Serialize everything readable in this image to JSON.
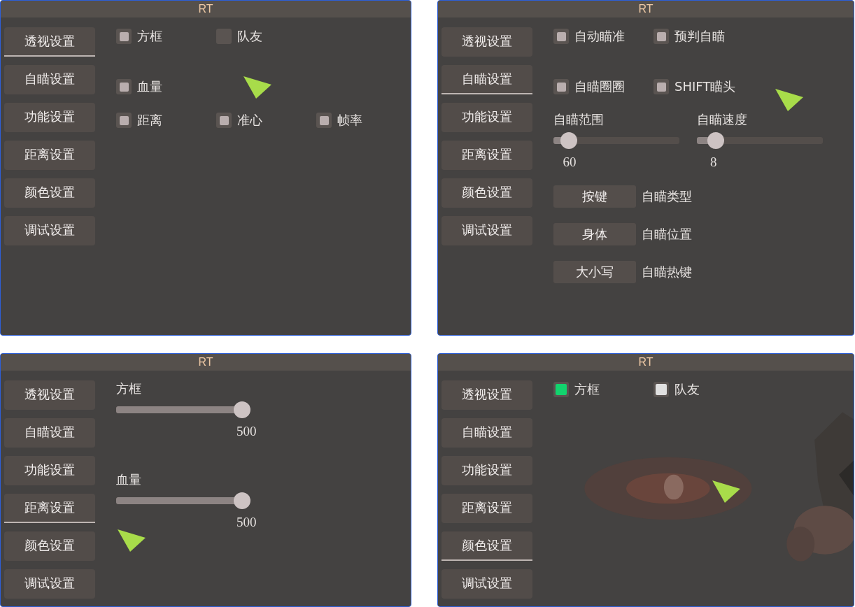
{
  "panels": [
    {
      "title": "RT",
      "tabs": [
        {
          "label": "透视设置",
          "selected": true
        },
        {
          "label": "自瞄设置",
          "selected": false
        },
        {
          "label": "功能设置",
          "selected": false
        },
        {
          "label": "距离设置",
          "selected": false
        },
        {
          "label": "颜色设置",
          "selected": false
        },
        {
          "label": "调试设置",
          "selected": false
        }
      ],
      "rows": [
        [
          {
            "kind": "checkbox",
            "label": "方框",
            "checked": true
          },
          {
            "kind": "checkbox",
            "label": "队友",
            "checked": false
          }
        ],
        [
          {
            "kind": "checkbox",
            "label": "血量",
            "checked": true
          }
        ],
        [
          {
            "kind": "checkbox",
            "label": "距离",
            "checked": true
          },
          {
            "kind": "checkbox",
            "label": "准心",
            "checked": true
          },
          {
            "kind": "checkbox",
            "label": "帧率",
            "checked": true
          }
        ]
      ]
    },
    {
      "title": "RT",
      "tabs": [
        {
          "label": "透视设置",
          "selected": false
        },
        {
          "label": "自瞄设置",
          "selected": true
        },
        {
          "label": "功能设置",
          "selected": false
        },
        {
          "label": "距离设置",
          "selected": false
        },
        {
          "label": "颜色设置",
          "selected": false
        },
        {
          "label": "调试设置",
          "selected": false
        }
      ],
      "rows": [
        [
          {
            "kind": "checkbox",
            "label": "自动瞄准",
            "checked": true
          },
          {
            "kind": "checkbox",
            "label": "预判自瞄",
            "checked": true
          }
        ],
        [
          {
            "kind": "checkbox",
            "label": "自瞄圈圈",
            "checked": true
          },
          {
            "kind": "checkbox",
            "label": "SHIFT瞄头",
            "checked": true
          }
        ],
        [
          {
            "kind": "slider",
            "label": "自瞄范围",
            "level": 0.12,
            "reading": "60"
          },
          {
            "kind": "slider",
            "label": "自瞄速度",
            "level": 0.15,
            "reading": "8"
          }
        ],
        [
          {
            "kind": "option",
            "value": "按键",
            "label": "自瞄类型"
          }
        ],
        [
          {
            "kind": "option",
            "value": "身体",
            "label": "自瞄位置"
          }
        ],
        [
          {
            "kind": "option",
            "value": "大小写",
            "label": "自瞄热键"
          }
        ]
      ]
    },
    {
      "title": "RT",
      "tabs": [
        {
          "label": "透视设置",
          "selected": false
        },
        {
          "label": "自瞄设置",
          "selected": false
        },
        {
          "label": "功能设置",
          "selected": false
        },
        {
          "label": "距离设置",
          "selected": true
        },
        {
          "label": "颜色设置",
          "selected": false
        },
        {
          "label": "调试设置",
          "selected": false
        }
      ],
      "rows": [
        [
          {
            "kind": "slider",
            "label": "方框",
            "level": 1,
            "reading": "500"
          }
        ],
        [
          {
            "kind": "slider",
            "label": "血量",
            "level": 1,
            "reading": "500"
          }
        ]
      ]
    },
    {
      "title": "RT",
      "tabs": [
        {
          "label": "透视设置",
          "selected": false
        },
        {
          "label": "自瞄设置",
          "selected": false
        },
        {
          "label": "功能设置",
          "selected": false
        },
        {
          "label": "距离设置",
          "selected": false
        },
        {
          "label": "颜色设置",
          "selected": true
        },
        {
          "label": "调试设置",
          "selected": false
        }
      ],
      "rows": [
        [
          {
            "kind": "color",
            "label": "方框",
            "color": "#12d46e"
          },
          {
            "kind": "color",
            "label": "队友",
            "color": "#e0e0e0"
          }
        ]
      ]
    }
  ]
}
